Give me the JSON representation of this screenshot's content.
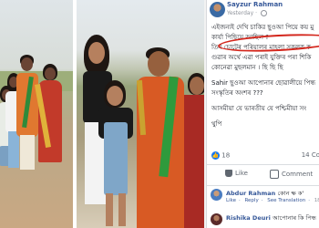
{
  "post": {
    "author": "Sayzur Rahman",
    "time": "Yesterday",
    "lines": [
      "এইজন্যই দেখি চাকির ছুওআ পিয়ে কয় মু",
      "কাৰ্যা পিছিয়ে আছিল ?",
      "তিন চোটেৰ পৰিয়ালৰ মাহলা সকলক ক",
      "গুৱাৰ অৰ্থে এৱা পৰাই যুক্তিৰ পৰা শিকি",
      "কোনেৱা মুছলমান । ছি ছি ছি",
      "Sahir ছুওআ আপোনাৰ ছোৱালীয়ে পিন্ধ",
      "সংস্কৃতিৰ অংশৰ ???",
      "আসমীয়া যে ভাৰতীয় যে পশ্চিমীয়া সং",
      "থুপি"
    ],
    "reaction_count": "18",
    "comment_count": "14 Co",
    "like_label": "Like",
    "comment_label": "Comment"
  },
  "comments": [
    {
      "name": "Abdur Rahman",
      "text": "কোন ক্ষ ক'",
      "links": [
        "Like",
        "Reply",
        "See Translation",
        "18"
      ]
    },
    {
      "name": "Rishika Deuri",
      "text": "আপোনাৰ কি পিন্ধ",
      "links": []
    }
  ],
  "colors": {
    "facebook_blue": "#365899",
    "like_blue": "#1877f2",
    "highlight_red": "#d3261c"
  }
}
